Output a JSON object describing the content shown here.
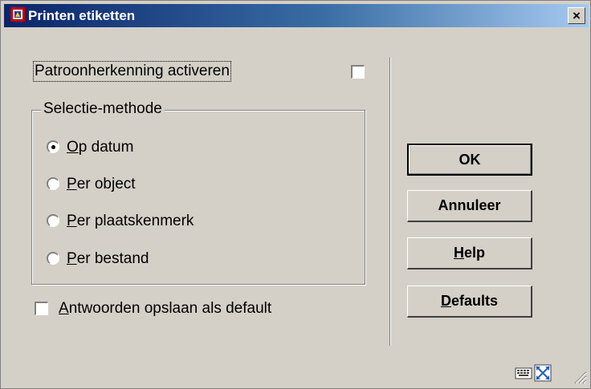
{
  "window": {
    "title": "Printen etiketten",
    "close_label": "×"
  },
  "pattern": {
    "label": "Patroonherkenning activeren",
    "checked": false
  },
  "selection": {
    "legend": "Selectie-methode",
    "options": [
      {
        "first": "O",
        "rest": "p datum",
        "selected": true
      },
      {
        "first": "P",
        "rest": "er object",
        "selected": false
      },
      {
        "first": "P",
        "rest": "er plaatskenmerk",
        "selected": false
      },
      {
        "first": "P",
        "rest": "er bestand",
        "selected": false
      }
    ]
  },
  "save_defaults": {
    "first": "A",
    "rest": "ntwoorden opslaan als default",
    "checked": false
  },
  "buttons": {
    "ok": "OK",
    "cancel": "Annuleer",
    "help_first": "H",
    "help_rest": "elp",
    "defaults_first": "D",
    "defaults_rest": "efaults"
  },
  "icons": {
    "title_icon": "app-icon",
    "bottom": [
      "keyboard-icon",
      "resize-icon",
      "size-grip-icon"
    ]
  },
  "colors": {
    "title_start": "#0a246a",
    "title_end": "#a6caf0",
    "face": "#d4d0c8"
  }
}
